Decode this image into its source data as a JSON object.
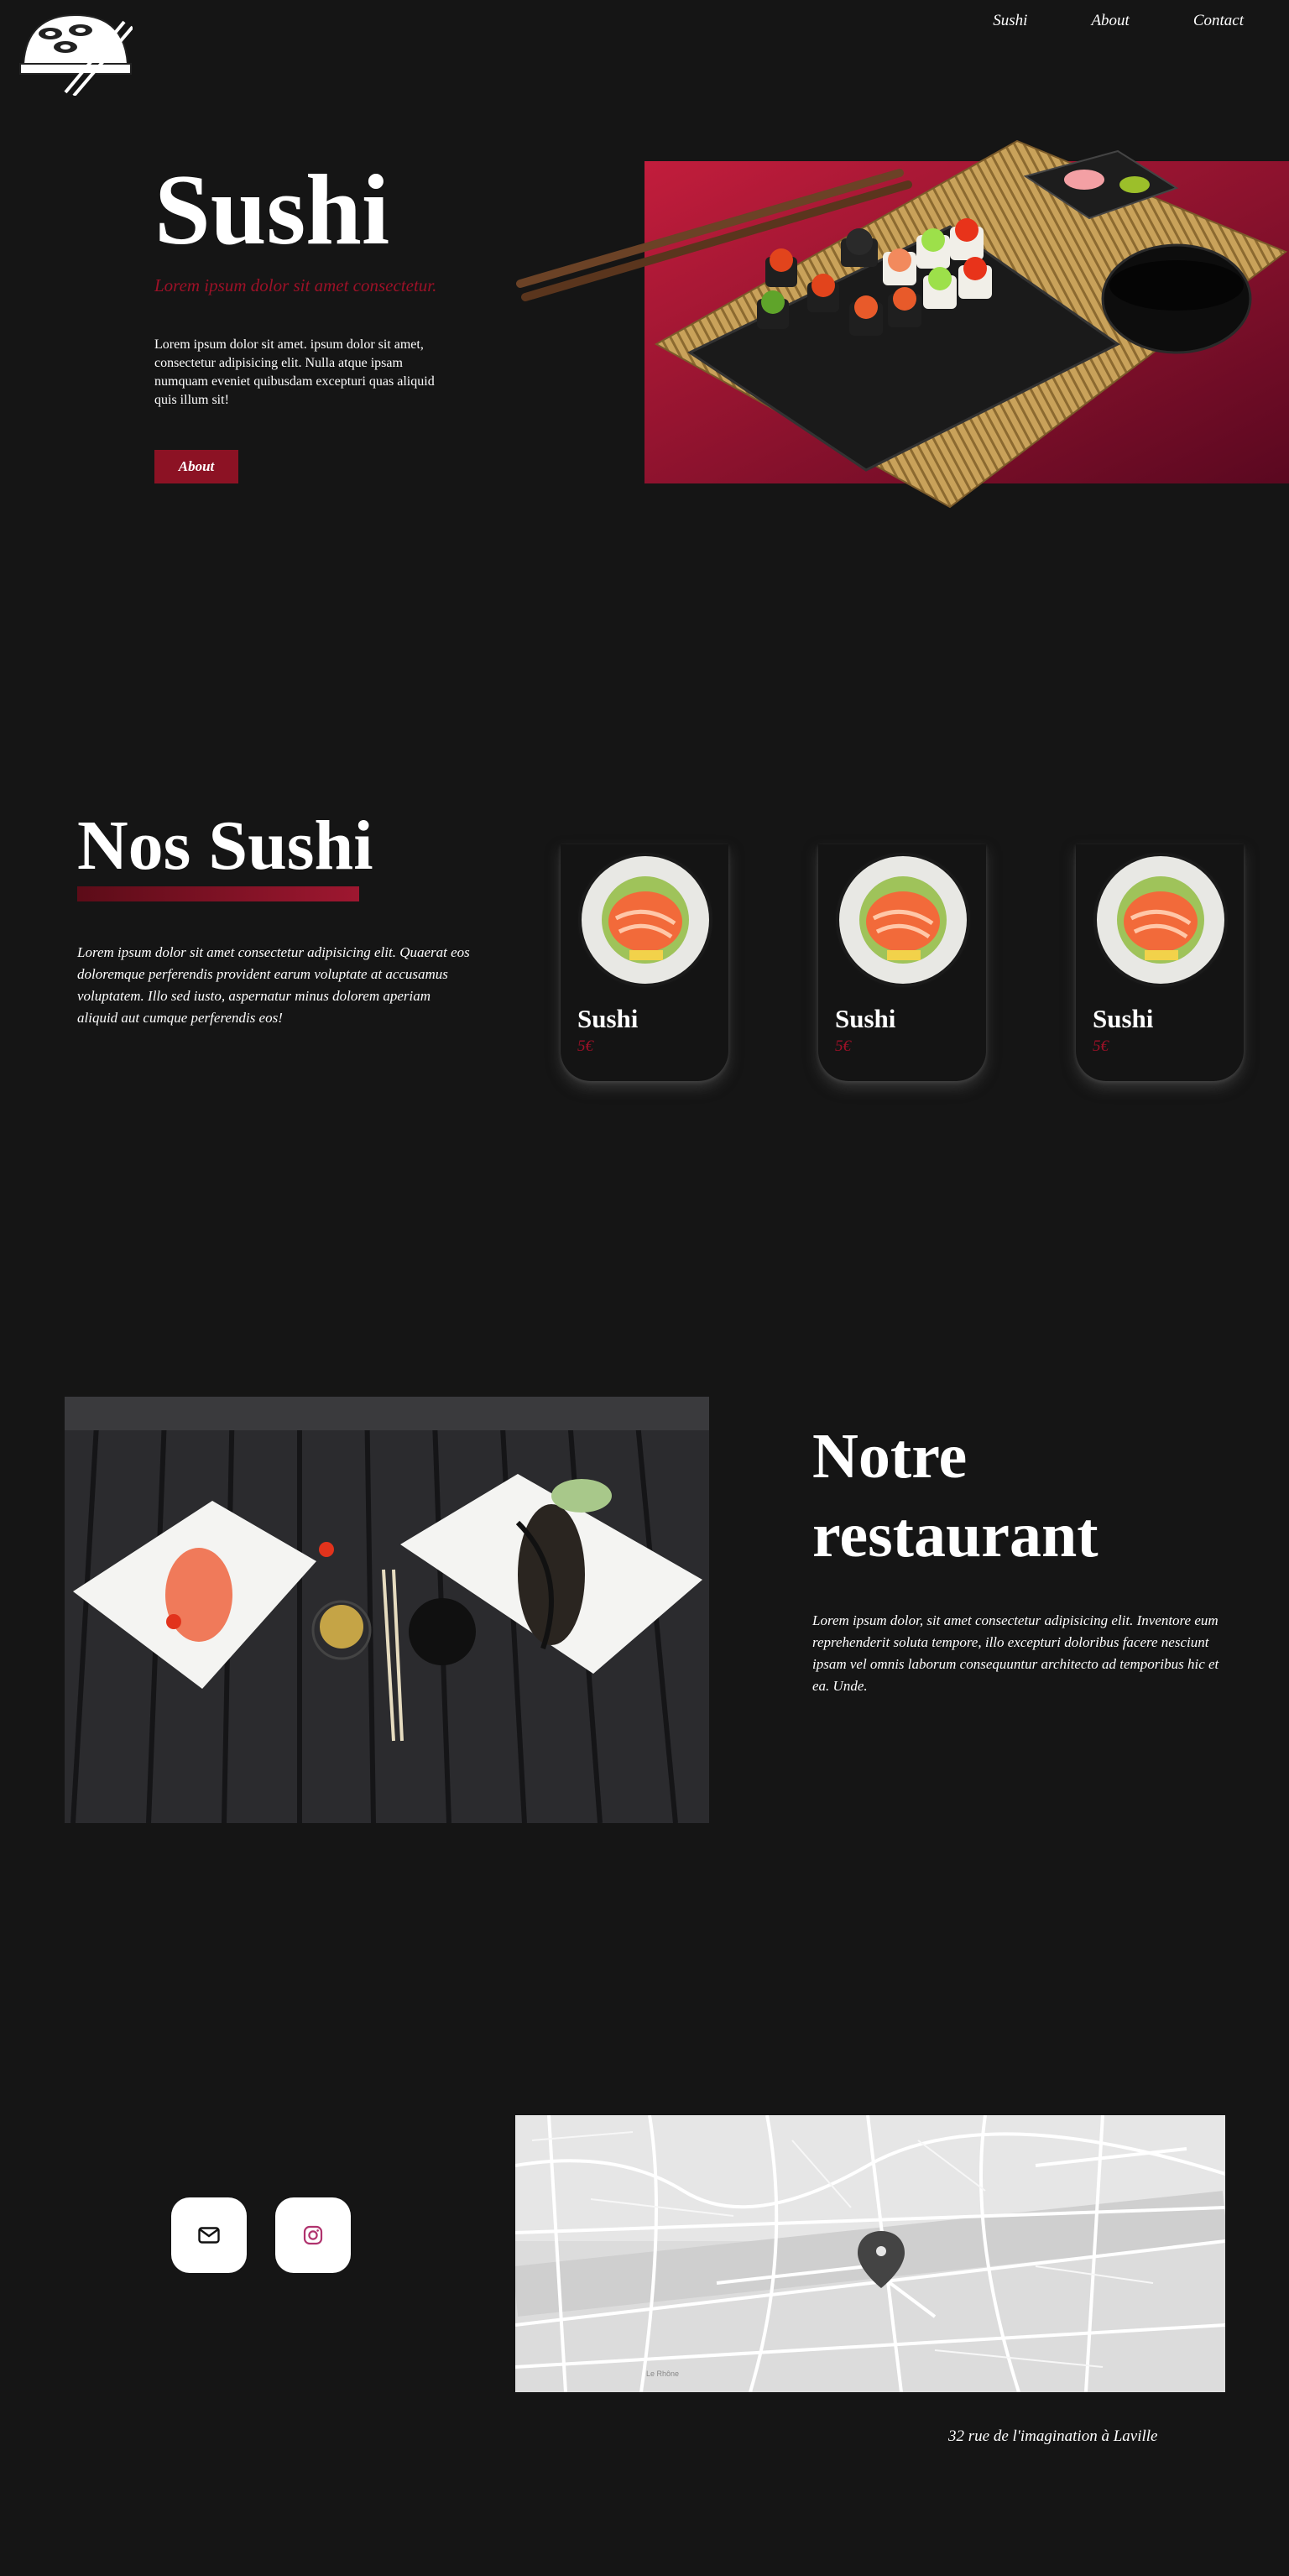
{
  "nav": {
    "links": [
      "Sushi",
      "About",
      "Contact"
    ]
  },
  "hero": {
    "title": "Sushi",
    "subtitle": "Lorem ipsum dolor sit amet consectetur.",
    "text": "Lorem ipsum dolor sit amet. ipsum dolor sit amet, consectetur adipisicing elit. Nulla atque ipsam numquam eveniet quibusdam excepturi quas aliquid quis illum sit!",
    "button_label": "About"
  },
  "nos_sushi": {
    "title": "Nos Sushi",
    "text": "Lorem ipsum dolor sit amet consectetur adipisicing elit. Quaerat eos doloremque perferendis provident earum voluptate at accusamus voluptatem. Illo sed iusto, aspernatur minus dolorem aperiam aliquid aut cumque perferendis eos!",
    "cards": [
      {
        "name": "Sushi",
        "price": "5€"
      },
      {
        "name": "Sushi",
        "price": "5€"
      },
      {
        "name": "Sushi",
        "price": "5€"
      }
    ]
  },
  "restaurant": {
    "title_line1": "Notre",
    "title_line2": "restaurant",
    "text": "Lorem ipsum dolor, sit amet consectetur adipisicing elit. Inventore eum reprehenderit soluta tempore, illo excepturi doloribus facere nesciunt ipsam vel omnis laborum consequuntur architecto ad temporibus hic et ea. Unde."
  },
  "contact": {
    "icons": [
      "envelope-icon",
      "instagram-icon"
    ],
    "map_labels": [
      "Le Rhône"
    ],
    "address": "32 rue de l'imagination à Laville"
  },
  "colors": {
    "background": "#151515",
    "accent": "#9c1127",
    "button": "#8c1224"
  }
}
